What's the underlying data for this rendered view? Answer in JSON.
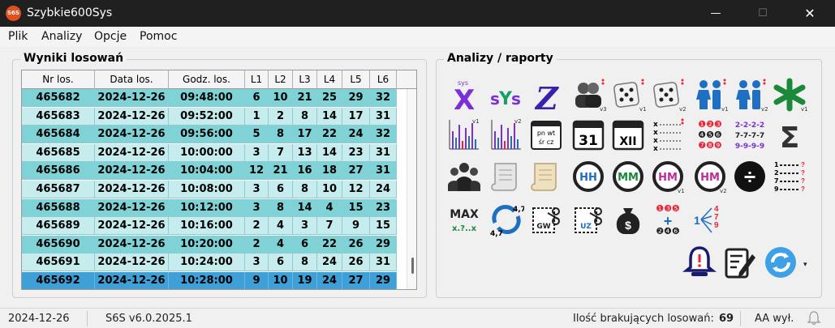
{
  "window": {
    "app_icon_text": "S6S",
    "title": "Szybkie600Sys",
    "minimize": "—",
    "maximize": "☐",
    "close": "✕"
  },
  "menu": [
    "Plik",
    "Analizy",
    "Opcje",
    "Pomoc"
  ],
  "results": {
    "title": "Wyniki losowań",
    "columns": [
      "Nr los.",
      "Data los.",
      "Godz. los.",
      "L1",
      "L2",
      "L3",
      "L4",
      "L5",
      "L6"
    ],
    "rows": [
      [
        "465682",
        "2024-12-26",
        "09:48:00",
        "6",
        "10",
        "21",
        "25",
        "29",
        "32"
      ],
      [
        "465683",
        "2024-12-26",
        "09:52:00",
        "1",
        "2",
        "8",
        "14",
        "17",
        "31"
      ],
      [
        "465684",
        "2024-12-26",
        "09:56:00",
        "5",
        "8",
        "17",
        "22",
        "24",
        "32"
      ],
      [
        "465685",
        "2024-12-26",
        "10:00:00",
        "3",
        "7",
        "13",
        "14",
        "23",
        "31"
      ],
      [
        "465686",
        "2024-12-26",
        "10:04:00",
        "12",
        "21",
        "16",
        "18",
        "27",
        "31"
      ],
      [
        "465687",
        "2024-12-26",
        "10:08:00",
        "3",
        "6",
        "8",
        "10",
        "12",
        "24"
      ],
      [
        "465688",
        "2024-12-26",
        "10:12:00",
        "3",
        "8",
        "14",
        "4",
        "15",
        "23"
      ],
      [
        "465689",
        "2024-12-26",
        "10:16:00",
        "2",
        "4",
        "3",
        "7",
        "9",
        "15"
      ],
      [
        "465690",
        "2024-12-26",
        "10:20:00",
        "2",
        "4",
        "6",
        "22",
        "26",
        "29"
      ],
      [
        "465691",
        "2024-12-26",
        "10:24:00",
        "3",
        "6",
        "8",
        "24",
        "26",
        "31"
      ],
      [
        "465692",
        "2024-12-26",
        "10:28:00",
        "9",
        "10",
        "19",
        "24",
        "27",
        "29"
      ]
    ],
    "selected_row": 10
  },
  "analyses": {
    "title": "Analizy / raporty",
    "icons": [
      {
        "name": "sys-x-icon",
        "text": "X",
        "sub": "sys",
        "color": "#7b2fd6"
      },
      {
        "name": "sys-text-icon",
        "text": "sYs",
        "color": "#7b2fd6"
      },
      {
        "name": "z-letter-icon",
        "text": "Z",
        "color": "#3b1fb0"
      },
      {
        "name": "users-v3-icon",
        "sub": "v3"
      },
      {
        "name": "dice-v1-icon",
        "sub": "v1"
      },
      {
        "name": "dice-v2-icon",
        "sub": "v2"
      },
      {
        "name": "couple-v1-icon",
        "sub": "v1"
      },
      {
        "name": "couple-v2-icon",
        "sub": "v2"
      },
      {
        "name": "green-star-icon",
        "sub": "v1"
      },
      {
        "name": "bar-chart-v1-icon",
        "sub": "v1"
      },
      {
        "name": "bar-chart-v2-icon",
        "sub": "v2"
      },
      {
        "name": "calendar-weekday-icon",
        "text": "pn wt śr cz"
      },
      {
        "name": "calendar-31-icon",
        "text": "31"
      },
      {
        "name": "calendar-xii-icon",
        "text": "XII"
      },
      {
        "name": "x-list-icon"
      },
      {
        "name": "numbers-grid-icon",
        "rows": [
          "❶❷❸",
          "❹❺❻",
          "❼❽❾"
        ]
      },
      {
        "name": "repeat-numbers-icon",
        "rows": [
          "2-2-2-2",
          "7-7-7-7",
          "9-9-9-9"
        ]
      },
      {
        "name": "sigma-icon",
        "text": "Σ"
      },
      {
        "name": "group-icon"
      },
      {
        "name": "scroll-gray-icon"
      },
      {
        "name": "scroll-tan-icon"
      },
      {
        "name": "clock-hh-icon",
        "text": "HH"
      },
      {
        "name": "clock-mm-icon",
        "text": "MM"
      },
      {
        "name": "clock-hm-v1-icon",
        "text": "HM",
        "sub": "v1"
      },
      {
        "name": "clock-hm-v2-icon",
        "text": "HM",
        "sub": "v2"
      },
      {
        "name": "divide-icon",
        "text": "÷"
      },
      {
        "name": "numbered-list-icon"
      },
      {
        "name": "max-icon",
        "text": "MAX",
        "sub": "x.?..x"
      },
      {
        "name": "refresh-47-icon",
        "text": "4,7"
      },
      {
        "name": "cut-gw-icon",
        "text": "GW"
      },
      {
        "name": "cut-uz-icon",
        "text": "UZ"
      },
      {
        "name": "money-bag-icon",
        "text": "$"
      },
      {
        "name": "plus-numbers-icon",
        "rows": [
          "❶❸❺",
          "❷❹❻"
        ]
      },
      {
        "name": "number-tree-icon",
        "text": "1 4 7 9"
      },
      {
        "name": "alarm-bell-icon"
      },
      {
        "name": "edit-document-icon"
      },
      {
        "name": "sync-icon"
      }
    ]
  },
  "status": {
    "date": "2024-12-26",
    "version": "S6S v6.0.2025.1",
    "missing_label": "Ilość brakujących losowań:",
    "missing_count": "69",
    "aa": "AA wył.",
    "dropdown": "▾"
  }
}
